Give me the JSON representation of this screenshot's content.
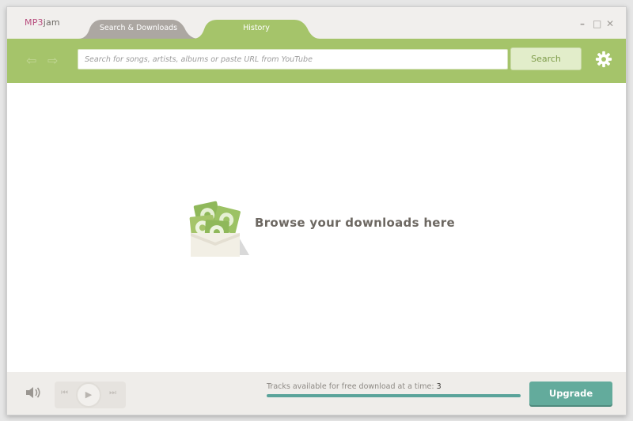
{
  "app": {
    "logo_prefix": "MP3",
    "logo_suffix": "jam"
  },
  "tabs": [
    {
      "label": "Search & Downloads",
      "active": false
    },
    {
      "label": "History",
      "active": true
    }
  ],
  "window_controls": {
    "minimize": "–",
    "maximize": "□",
    "close": "✕"
  },
  "toolbar": {
    "back_icon": "⇦",
    "forward_icon": "⇨",
    "search_placeholder": "Search for songs, artists, albums or paste URL from YouTube",
    "search_value": "",
    "search_button": "Search"
  },
  "content": {
    "empty_message": "Browse your downloads here"
  },
  "footer": {
    "tracks_label": "Tracks available for free download at a time: ",
    "tracks_count": "3",
    "upgrade_label": "Upgrade",
    "progress_fraction": 1.0
  },
  "colors": {
    "accent_green": "#a5c46a",
    "teal": "#63ab9c",
    "logo_pink": "#b84c7d"
  }
}
